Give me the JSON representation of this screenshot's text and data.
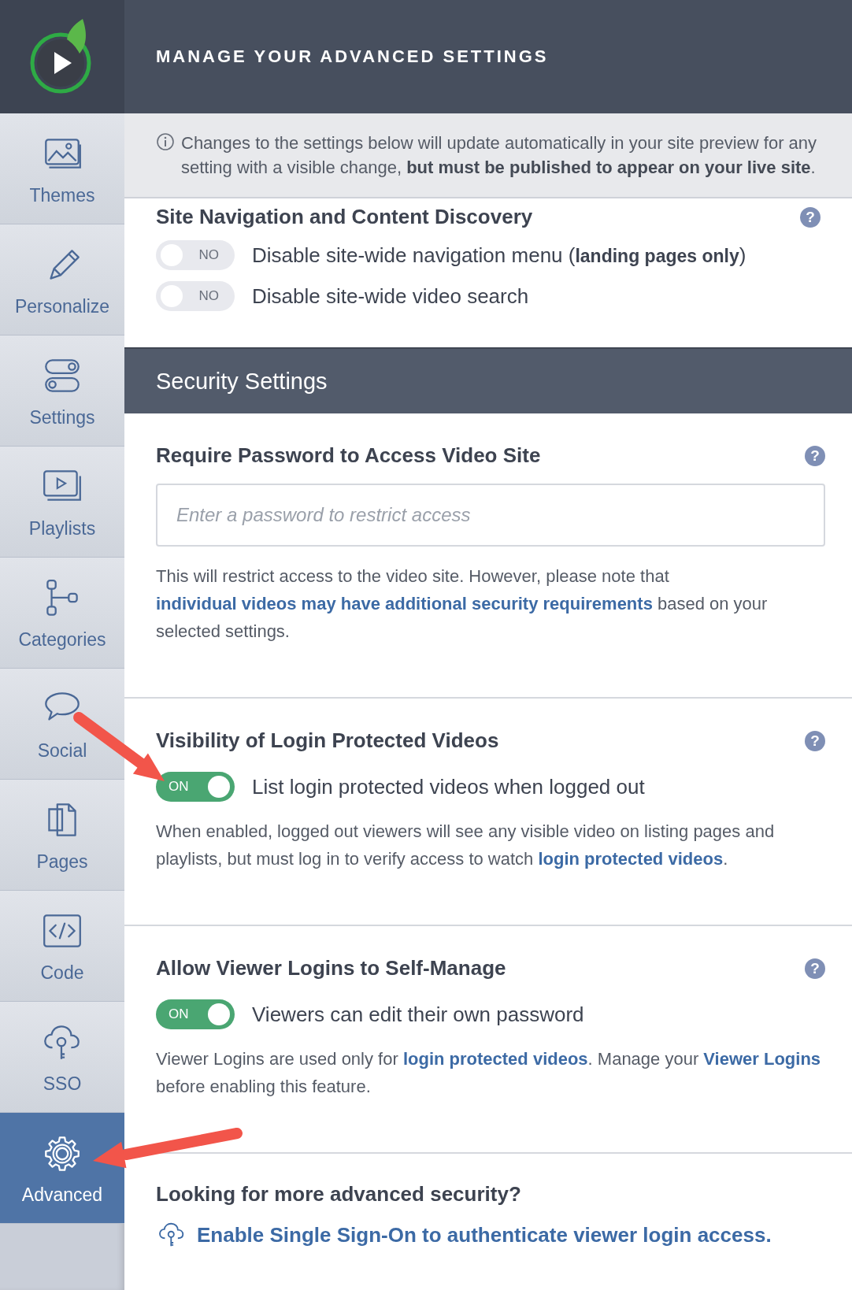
{
  "sidebar": {
    "items": [
      {
        "kind": "themes",
        "label": "Themes",
        "selected": false
      },
      {
        "kind": "personalize",
        "label": "Personalize",
        "selected": false
      },
      {
        "kind": "settings",
        "label": "Settings",
        "selected": false
      },
      {
        "kind": "playlists",
        "label": "Playlists",
        "selected": false
      },
      {
        "kind": "categories",
        "label": "Categories",
        "selected": false
      },
      {
        "kind": "social",
        "label": "Social",
        "selected": false
      },
      {
        "kind": "pages",
        "label": "Pages",
        "selected": false
      },
      {
        "kind": "code",
        "label": "Code",
        "selected": false
      },
      {
        "kind": "sso",
        "label": "SSO",
        "selected": false
      },
      {
        "kind": "advanced",
        "label": "Advanced",
        "selected": true
      }
    ]
  },
  "header": {
    "title": "MANAGE YOUR ADVANCED SETTINGS"
  },
  "notice": {
    "text": "Changes to the settings below will update automatically in your site preview for any setting with a visible change, **but must be published to appear on your live site**."
  },
  "site_navigation": {
    "title": "Site Navigation and Content Discovery",
    "help": "?",
    "toggles": [
      {
        "on": false,
        "state_label": "NO",
        "label": "Disable site-wide navigation menu (**landing pages only**)"
      },
      {
        "on": false,
        "state_label": "NO",
        "label": "Disable site-wide video search"
      }
    ]
  },
  "security": {
    "title": "Security Settings",
    "blocks": [
      {
        "kind": "password",
        "title": "Require Password to Access Video Site",
        "help": "?",
        "placeholder": "Enter a password to restrict access",
        "description": [
          {
            "text": "This will restrict access to the video site. However, please note that "
          },
          {
            "text": "individual videos may have additional security requirements",
            "link": true
          },
          {
            "text": " based on your selected settings."
          }
        ]
      },
      {
        "kind": "toggle",
        "title": "Visibility of Login Protected Videos",
        "help": "?",
        "toggle": {
          "on": true,
          "state_label": "ON",
          "label": "List login protected videos when logged out"
        },
        "description": [
          {
            "text": "When enabled, logged out viewers will see any visible video on listing pages and playlists, but must log in to verify access to watch "
          },
          {
            "text": "login protected videos",
            "link": true
          },
          {
            "text": "."
          }
        ]
      },
      {
        "kind": "toggle",
        "title": "Allow Viewer Logins to Self-Manage",
        "help": "?",
        "toggle": {
          "on": true,
          "state_label": "ON",
          "label": "Viewers can edit their own password"
        },
        "description": [
          {
            "text": "Viewer Logins are used only for "
          },
          {
            "text": "login protected videos",
            "link": true
          },
          {
            "text": ". Manage your "
          },
          {
            "text": "Viewer Logins",
            "link": true
          },
          {
            "text": " before enabling this feature."
          }
        ]
      }
    ],
    "more": {
      "title": "Looking for more advanced security?",
      "link": "Enable Single Sign-On to authenticate viewer login access."
    }
  }
}
